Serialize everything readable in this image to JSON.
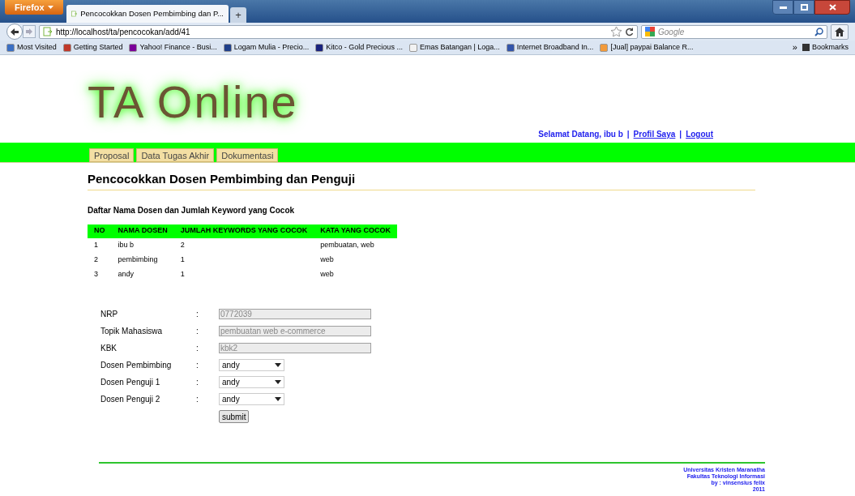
{
  "browser": {
    "menu_button": "Firefox",
    "tab_title": "Pencocokkan Dosen Pembimbing dan P...",
    "new_tab": "+",
    "url": "http://localhost/ta/pencocokan/add/41",
    "search_placeholder": "Google",
    "bookmarks": [
      {
        "label": "Most Visited",
        "color": "#3a6fc4"
      },
      {
        "label": "Getting Started",
        "color": "#c0392b"
      },
      {
        "label": "Yahoo! Finance - Busi...",
        "color": "#7b0099"
      },
      {
        "label": "Logam Mulia - Precio...",
        "color": "#1f3f8a"
      },
      {
        "label": "Kitco - Gold Precious ...",
        "color": "#1a237e"
      },
      {
        "label": "Emas Batangan | Loga...",
        "color": "#f2f2f2"
      },
      {
        "label": "Internet Broadband In...",
        "color": "#3355aa"
      },
      {
        "label": "[Jual] paypai Balance R...",
        "color": "#f29a3a"
      }
    ],
    "overflow": "»",
    "bookmarks_menu": "Bookmarks"
  },
  "page": {
    "logo": "TA Online",
    "welcome": [
      {
        "kind": "text",
        "text": "Selamat Datang, ibu b"
      },
      {
        "kind": "sep",
        "text": "|"
      },
      {
        "kind": "link",
        "text": "Profil Saya"
      },
      {
        "kind": "sep",
        "text": "|"
      },
      {
        "kind": "link",
        "text": "Logout"
      }
    ],
    "nav_tabs": [
      "Proposal",
      "Data Tugas Akhir",
      "Dokumentasi"
    ],
    "title": "Pencocokkan Dosen Pembimbing dan Penguji",
    "subtitle": "Daftar Nama Dosen dan Jumlah Keyword yang Cocok",
    "table": {
      "columns": [
        "NO",
        "NAMA DOSEN",
        "JUMLAH KEYWORDS YANG COCOK",
        "KATA YANG COCOK"
      ],
      "rows": [
        [
          "1",
          "ibu b",
          "2",
          "pembuatan, web"
        ],
        [
          "2",
          "pembimbing",
          "1",
          "web"
        ],
        [
          "3",
          "andy",
          "1",
          "web"
        ]
      ]
    },
    "form": [
      {
        "kind": "text",
        "label": "NRP",
        "separator": ":",
        "value": "0772039",
        "disabled": true
      },
      {
        "kind": "text",
        "label": "Topik Mahasiswa",
        "separator": ":",
        "value": "pembuatan web e-commerce",
        "disabled": true
      },
      {
        "kind": "text",
        "label": "KBK",
        "separator": ":",
        "value": "kbk2",
        "disabled": true
      },
      {
        "kind": "select",
        "label": "Dosen Pembimbing",
        "separator": ":",
        "value": "andy"
      },
      {
        "kind": "select",
        "label": "Dosen Penguji 1",
        "separator": ":",
        "value": "andy"
      },
      {
        "kind": "select",
        "label": "Dosen Penguji 2",
        "separator": ":",
        "value": "andy"
      }
    ],
    "submit": "submit",
    "footer": [
      "Universitas Kristen Maranatha",
      "Fakultas Teknologi Informasi",
      "by : vinsensius felix",
      "2011"
    ]
  }
}
